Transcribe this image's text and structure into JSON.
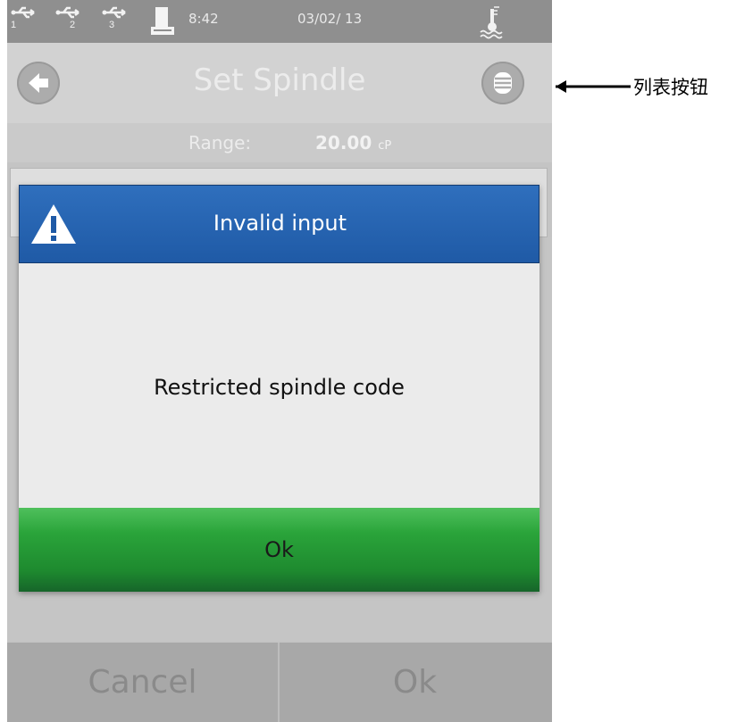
{
  "status_bar": {
    "usb_ports": [
      "1",
      "2",
      "3"
    ],
    "time": "8:42",
    "date": "03/02/ 13"
  },
  "header": {
    "title": "Set Spindle",
    "back_icon": "back-arrow-icon",
    "menu_icon": "list-menu-icon"
  },
  "range": {
    "label": "Range:",
    "value": "20.00",
    "unit": "cP"
  },
  "dialog": {
    "title": "Invalid input",
    "message": "Restricted spindle code",
    "ok_label": "Ok",
    "header_color": "#1f5aa6",
    "ok_color": "#2aa43a"
  },
  "bottom": {
    "cancel_label": "Cancel",
    "ok_label": "Ok"
  },
  "annotation": {
    "label": "列表按钮"
  }
}
